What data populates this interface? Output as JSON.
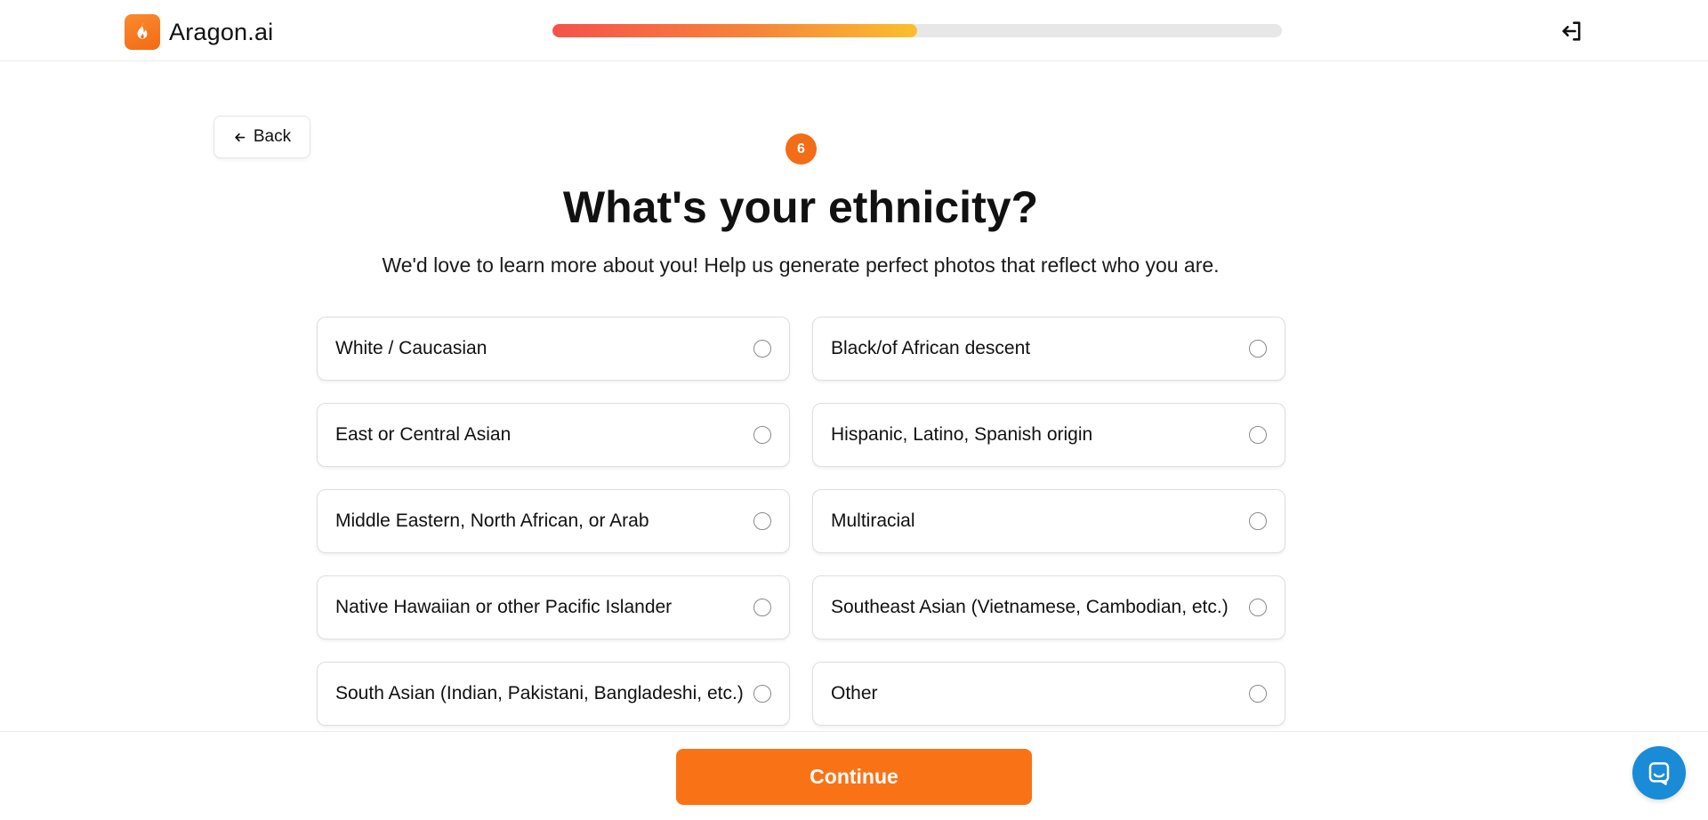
{
  "header": {
    "brand": "Aragon.ai",
    "progress_fraction": 0.5,
    "logo_icon": "flame-icon",
    "logout_icon": "logout-icon"
  },
  "back": {
    "label": "Back",
    "icon": "arrow-left-icon"
  },
  "step": {
    "number": "6"
  },
  "question": {
    "title": "What's your ethnicity?",
    "subtitle": "We'd love to learn more about you! Help us generate perfect photos that reflect who you are."
  },
  "options": [
    {
      "label": "White / Caucasian"
    },
    {
      "label": "Black/of African descent"
    },
    {
      "label": "East or Central Asian"
    },
    {
      "label": "Hispanic, Latino, Spanish origin"
    },
    {
      "label": "Middle Eastern, North African, or Arab"
    },
    {
      "label": "Multiracial"
    },
    {
      "label": "Native Hawaiian or other Pacific Islander"
    },
    {
      "label": "Southeast Asian (Vietnamese, Cambodian, etc.)"
    },
    {
      "label": "South Asian (Indian, Pakistani, Bangladeshi, etc.)"
    },
    {
      "label": "Other"
    }
  ],
  "footer": {
    "continue_label": "Continue",
    "chat_icon": "chat-icon"
  },
  "colors": {
    "accent": "#f97316",
    "progress_start": "#f5524a",
    "progress_end": "#fbbf2d",
    "chat": "#1a8bd6"
  }
}
